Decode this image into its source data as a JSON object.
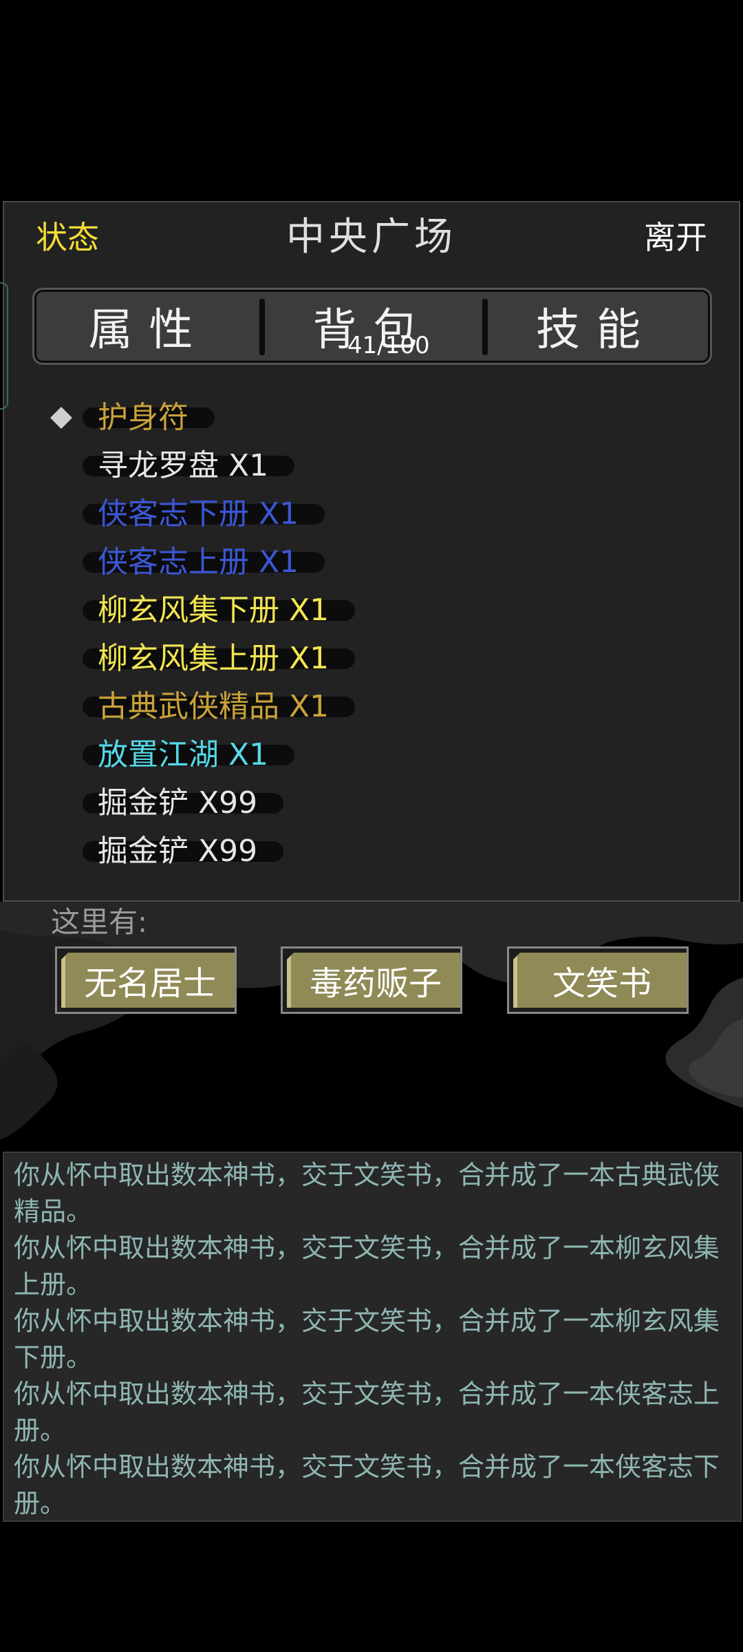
{
  "header": {
    "status_label": "状态",
    "title": "中央广场",
    "leave_label": "离开"
  },
  "tabs": [
    {
      "label": "属性"
    },
    {
      "label": "背包"
    },
    {
      "label": "技能"
    }
  ],
  "bag": {
    "capacity": "41/100"
  },
  "items": [
    {
      "label": "护身符",
      "color": "#c9a23a",
      "selected": true
    },
    {
      "label": "寻龙罗盘 X1",
      "color": "#e6e6e6"
    },
    {
      "label": "侠客志下册 X1",
      "color": "#3b57d6"
    },
    {
      "label": "侠客志上册 X1",
      "color": "#3b57d6"
    },
    {
      "label": "柳玄风集下册 X1",
      "color": "#f2e552"
    },
    {
      "label": "柳玄风集上册 X1",
      "color": "#f2e552"
    },
    {
      "label": "古典武侠精品 X1",
      "color": "#c9a23a"
    },
    {
      "label": "放置江湖 X1",
      "color": "#55d8e8"
    },
    {
      "label": "掘金铲 X99",
      "color": "#e6e6e6"
    },
    {
      "label": "掘金铲 X99",
      "color": "#e6e6e6"
    }
  ],
  "location": {
    "here_label": "这里有:",
    "npcs": [
      {
        "label": "无名居士"
      },
      {
        "label": "毒药贩子"
      },
      {
        "label": "文笑书"
      }
    ]
  },
  "log": [
    "你从怀中取出数本神书，交于文笑书，合并成了一本古典武侠精品。",
    "你从怀中取出数本神书，交于文笑书，合并成了一本柳玄风集上册。",
    "你从怀中取出数本神书，交于文笑书，合并成了一本柳玄风集下册。",
    "你从怀中取出数本神书，交于文笑书，合并成了一本侠客志上册。",
    "你从怀中取出数本神书，交于文笑书，合并成了一本侠客志下册。"
  ]
}
